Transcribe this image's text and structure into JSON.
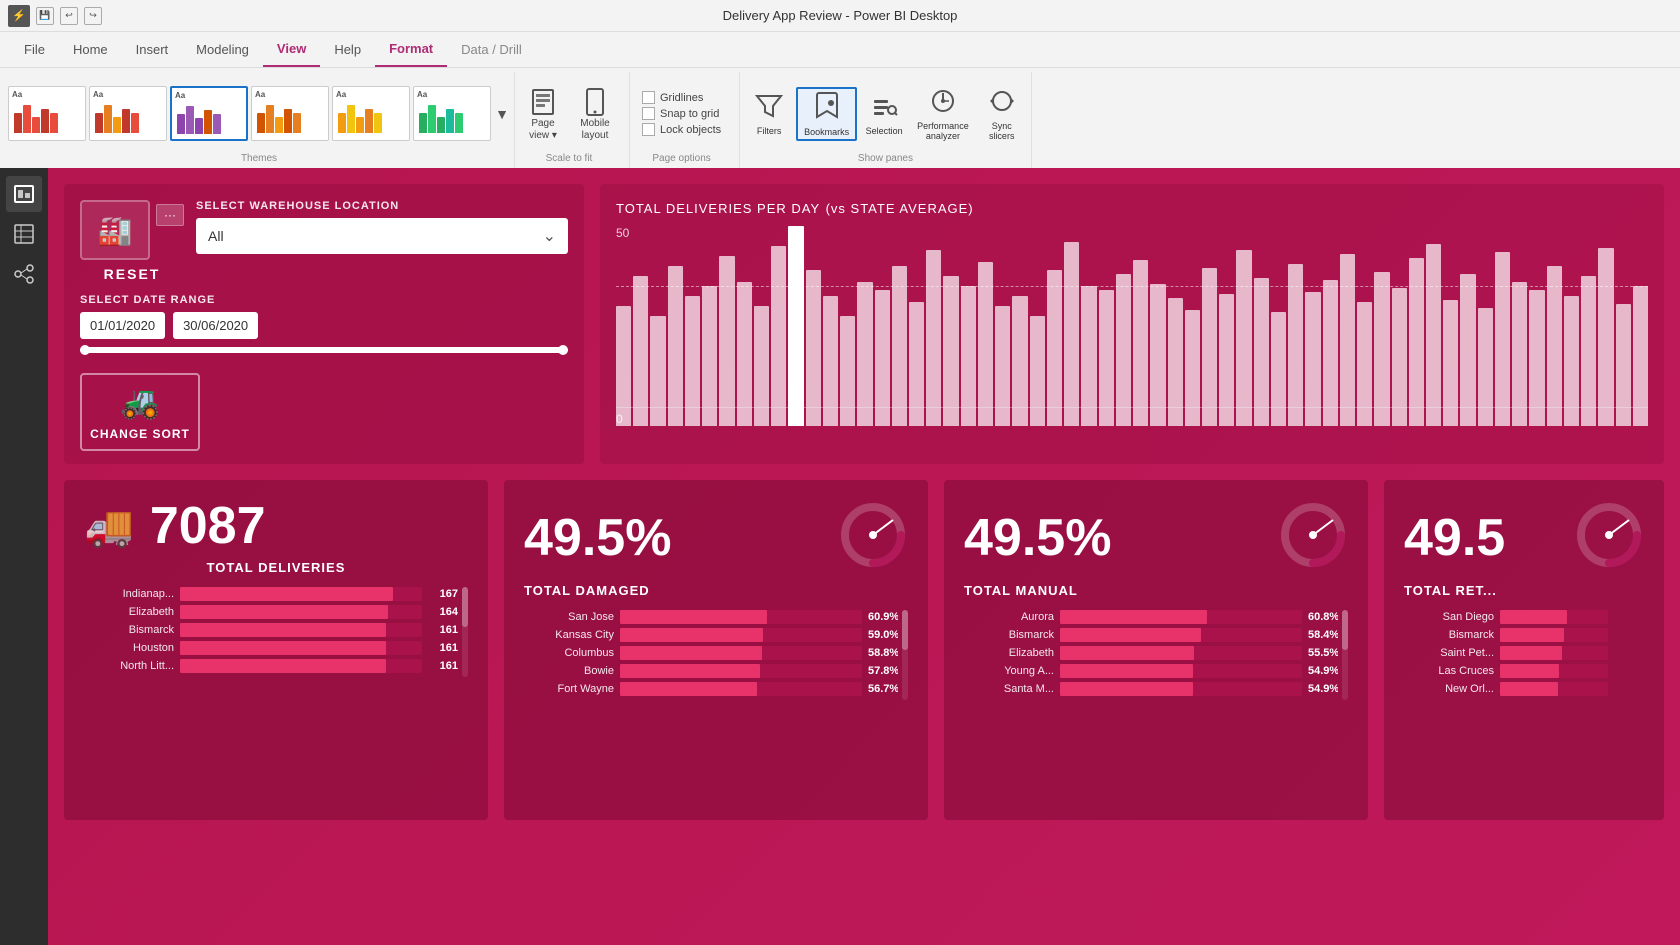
{
  "titleBar": {
    "title": "Delivery App Review - Power BI Desktop",
    "saveIcon": "💾",
    "undoIcon": "↩",
    "redoIcon": "↪"
  },
  "ribbon": {
    "tabs": [
      {
        "label": "File",
        "active": false
      },
      {
        "label": "Home",
        "active": false
      },
      {
        "label": "Insert",
        "active": false
      },
      {
        "label": "Modeling",
        "active": false
      },
      {
        "label": "View",
        "active": true
      },
      {
        "label": "Help",
        "active": false
      },
      {
        "label": "Format",
        "active": false
      },
      {
        "label": "Data / Drill",
        "active": false
      }
    ],
    "themes": {
      "label": "Themes",
      "items": [
        {
          "id": 1
        },
        {
          "id": 2,
          "selected": true
        },
        {
          "id": 3
        },
        {
          "id": 4
        },
        {
          "id": 5
        },
        {
          "id": 6
        }
      ]
    },
    "scaleGroup": {
      "label": "Scale to fit",
      "buttons": [
        {
          "label": "Page\nview",
          "icon": "⬛"
        },
        {
          "label": "Mobile\nlayout",
          "icon": "📱"
        }
      ]
    },
    "pageOptions": {
      "label": "Page options",
      "checkboxes": [
        {
          "label": "Gridlines",
          "checked": false
        },
        {
          "label": "Snap to grid",
          "checked": false
        },
        {
          "label": "Lock objects",
          "checked": false
        }
      ]
    },
    "showPanes": {
      "label": "Show panes",
      "buttons": [
        {
          "label": "Filters",
          "icon": "🔽",
          "active": false
        },
        {
          "label": "Bookmarks",
          "icon": "🔖",
          "active": true
        },
        {
          "label": "Selection",
          "icon": "📋",
          "active": false
        },
        {
          "label": "Performance\nanalyzer",
          "icon": "📊",
          "active": false
        },
        {
          "label": "Sync\nslicers",
          "icon": "🔄",
          "active": false
        }
      ]
    }
  },
  "dashboard": {
    "warehouseSection": {
      "icon": "🏭",
      "resetLabel": "RESET",
      "moreLabel": "...",
      "selectWarehouseLabel": "SELECT WAREHOUSE LOCATION",
      "dropdownValue": "All",
      "selectDateRangeLabel": "SELECT DATE RANGE",
      "dateFrom": "01/01/2020",
      "dateTo": "30/06/2020"
    },
    "changeSortLabel": "CHANGE SORT",
    "chartTitle": "TOTAL DELIVERIES PER DAY",
    "chartSubtitle": "(vs STATE AVERAGE)",
    "chartMaxLabel": "50",
    "chartMinLabel": "0",
    "kpis": [
      {
        "id": "total-deliveries",
        "icon": "🚚",
        "number": "7087",
        "label": "TOTAL DELIVERIES",
        "cities": [
          {
            "name": "Indianap...",
            "value": "167",
            "pct": 0.88
          },
          {
            "name": "Elizabeth",
            "value": "164",
            "pct": 0.86
          },
          {
            "name": "Bismarck",
            "value": "161",
            "pct": 0.85
          },
          {
            "name": "Houston",
            "value": "161",
            "pct": 0.85
          },
          {
            "name": "North Litt...",
            "value": "161",
            "pct": 0.85
          }
        ]
      },
      {
        "id": "total-damaged",
        "number": "49.5%",
        "label": "TOTAL DAMAGED",
        "gaugeValue": 0.495,
        "cities": [
          {
            "name": "San Jose",
            "value": "60.9%",
            "pct": 0.609
          },
          {
            "name": "Kansas City",
            "value": "59.0%",
            "pct": 0.59
          },
          {
            "name": "Columbus",
            "value": "58.8%",
            "pct": 0.588
          },
          {
            "name": "Bowie",
            "value": "57.8%",
            "pct": 0.578
          },
          {
            "name": "Fort Wayne",
            "value": "56.7%",
            "pct": 0.567
          }
        ]
      },
      {
        "id": "total-manual",
        "number": "49.5%",
        "label": "TOTAL MANUAL",
        "gaugeValue": 0.495,
        "cities": [
          {
            "name": "Aurora",
            "value": "60.8%",
            "pct": 0.608
          },
          {
            "name": "Bismarck",
            "value": "58.4%",
            "pct": 0.584
          },
          {
            "name": "Elizabeth",
            "value": "55.5%",
            "pct": 0.555
          },
          {
            "name": "Young A...",
            "value": "54.9%",
            "pct": 0.549
          },
          {
            "name": "Santa M...",
            "value": "54.9%",
            "pct": 0.549
          }
        ]
      },
      {
        "id": "total-ret",
        "number": "49.5",
        "label": "TOTAL RET...",
        "gaugeValue": 0.495,
        "cities": [
          {
            "name": "San Diego",
            "value": "",
            "pct": 0.62
          },
          {
            "name": "Bismarck",
            "value": "",
            "pct": 0.59
          },
          {
            "name": "Saint Pet...",
            "value": "",
            "pct": 0.57
          },
          {
            "name": "Las Cruces",
            "value": "",
            "pct": 0.55
          },
          {
            "name": "New Orl...",
            "value": "",
            "pct": 0.54
          }
        ]
      }
    ]
  }
}
